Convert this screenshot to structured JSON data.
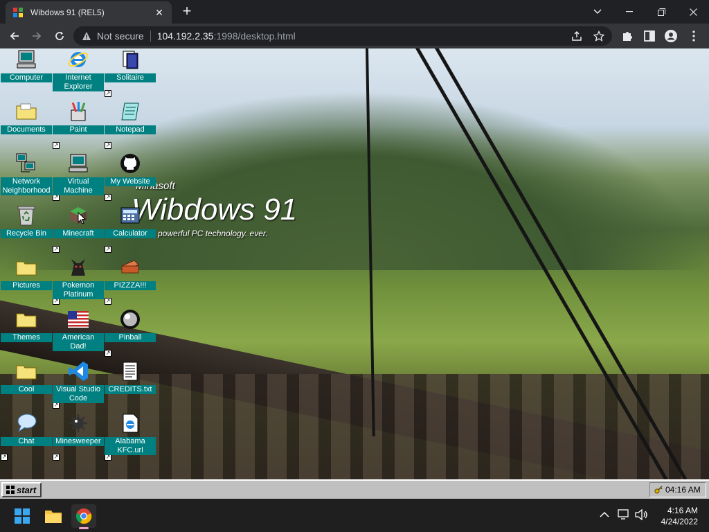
{
  "browser": {
    "tab_title": "Wibdows 91 (REL5)",
    "tab_close": "✕",
    "new_tab": "+",
    "security_label": "Not secure",
    "url_host": "104.192.2.35",
    "url_path": ":1998/desktop.html"
  },
  "branding": {
    "maker": "Minasoft",
    "product": "Wibdows 91",
    "tagline": "powerful PC technology. ever."
  },
  "desktop_icons": [
    {
      "label": "Computer"
    },
    {
      "label": "Internet Explorer"
    },
    {
      "label": "Solitaire"
    },
    {
      "label": "Documents"
    },
    {
      "label": "Paint"
    },
    {
      "label": "Notepad"
    },
    {
      "label": "Network Neighborhood"
    },
    {
      "label": "Virtual Machine"
    },
    {
      "label": "My Website"
    },
    {
      "label": "Recycle Bin"
    },
    {
      "label": "Minecraft"
    },
    {
      "label": "Calculator"
    },
    {
      "label": "Pictures"
    },
    {
      "label": "Pokemon Platinum"
    },
    {
      "label": "PIZZZA!!!"
    },
    {
      "label": "Themes"
    },
    {
      "label": "American Dad!"
    },
    {
      "label": "Pinball"
    },
    {
      "label": "Cool"
    },
    {
      "label": "Visual Studio Code"
    },
    {
      "label": "CREDITS.txt"
    },
    {
      "label": "Chat"
    },
    {
      "label": "Minesweeper"
    },
    {
      "label": "Alabama KFC.url"
    }
  ],
  "taskbar91": {
    "start_label": "start",
    "time": "04:16 AM"
  },
  "os_taskbar": {
    "time": "4:16 AM",
    "date": "4/24/2022"
  },
  "colors": {
    "icon_label_bg": "#008080",
    "win91_gray": "#c0c0c0",
    "chrome_dark": "#202124"
  }
}
